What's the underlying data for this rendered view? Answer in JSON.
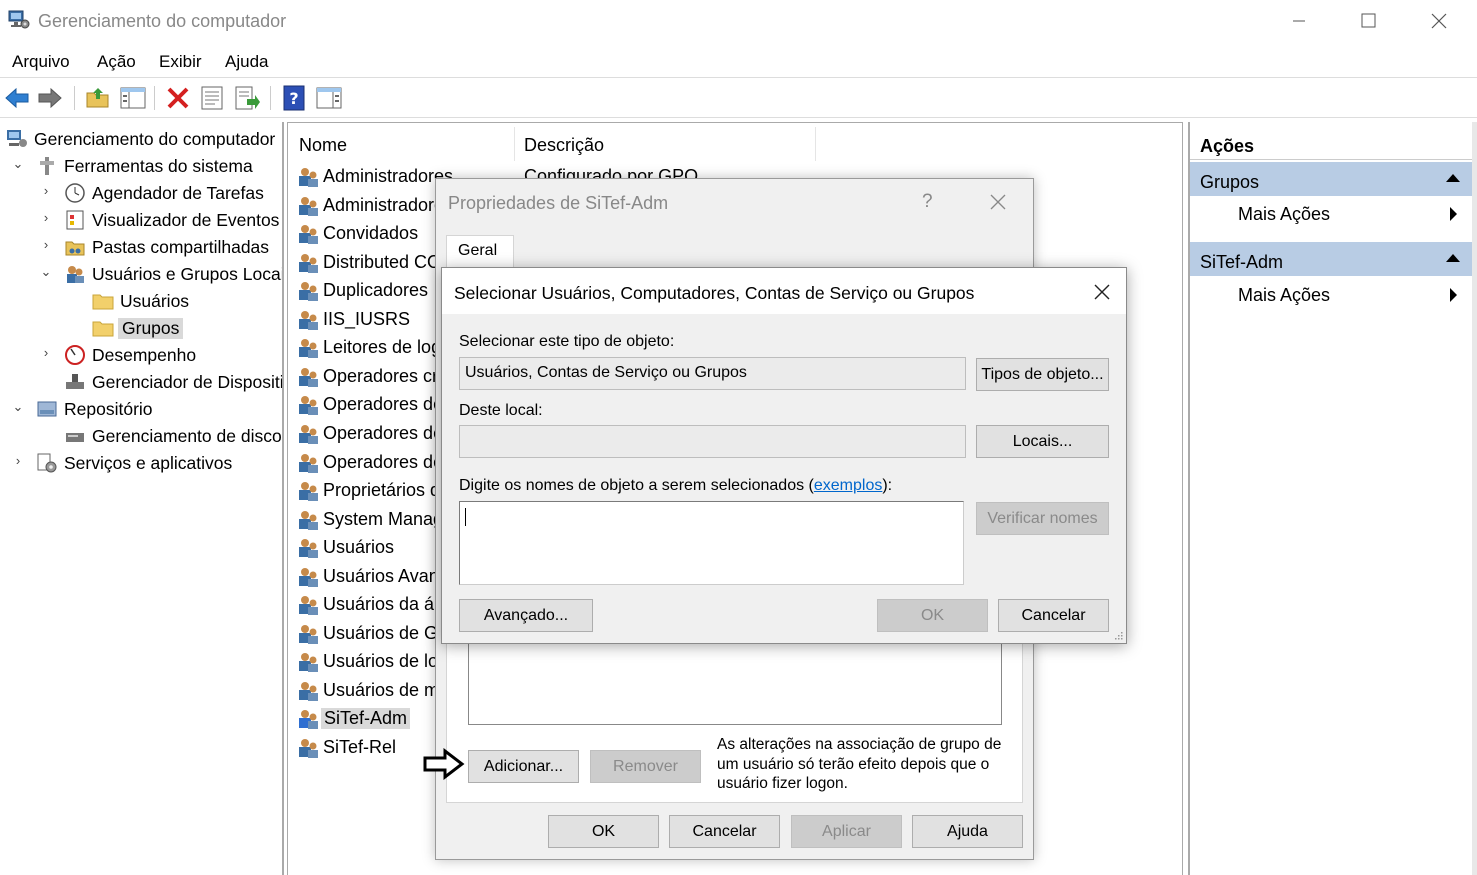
{
  "window": {
    "title": "Gerenciamento do computador"
  },
  "menu": [
    "Arquivo",
    "Ação",
    "Exibir",
    "Ajuda"
  ],
  "tree": {
    "root": "Gerenciamento do computador",
    "system_tools": "Ferramentas do sistema",
    "task_scheduler": "Agendador de Tarefas",
    "event_viewer": "Visualizador de Eventos",
    "shared_folders": "Pastas compartilhadas",
    "local_users_groups": "Usuários e Grupos Locais",
    "users": "Usuários",
    "groups": "Grupos",
    "performance": "Desempenho",
    "device_manager": "Gerenciador de Dispositivos",
    "storage": "Repositório",
    "disk_management": "Gerenciamento de disco",
    "services_apps": "Serviços e aplicativos"
  },
  "list": {
    "col_name": "Nome",
    "col_desc": "Descrição",
    "first_desc": "Configurado por GPO",
    "items": [
      "Administradores",
      "Administradores",
      "Convidados",
      "Distributed COM Users",
      "Duplicadores",
      "IIS_IUSRS",
      "Leitores de log de eventos",
      "Operadores criptográficos",
      "Operadores de backup",
      "Operadores de configuração de rede",
      "Operadores de controle de acesso",
      "Proprietários de dispositivos",
      "System Managed Accounts Group",
      "Usuários",
      "Usuários Avançados",
      "Usuários da área de trabalho remota",
      "Usuários de Gerenciamento Remoto",
      "Usuários de log de desempenho",
      "Usuários de monitor de desempenho",
      "SiTef-Adm",
      "SiTef-Rel"
    ]
  },
  "actions": {
    "title": "Ações",
    "group1": "Grupos",
    "group1_more": "Mais Ações",
    "group2": "SiTef-Adm",
    "group2_more": "Mais Ações"
  },
  "props_dialog": {
    "title": "Propriedades de SiTef-Adm",
    "help_glyph": "?",
    "tab": "Geral",
    "add": "Adicionar...",
    "remove": "Remover",
    "note": "As alterações na associação de grupo de um usuário só terão efeito depois que o usuário fizer logon.",
    "ok": "OK",
    "cancel": "Cancelar",
    "apply": "Aplicar",
    "help": "Ajuda"
  },
  "select_dialog": {
    "title": "Selecionar Usuários, Computadores, Contas de Serviço ou Grupos",
    "object_type_label": "Selecionar este tipo de objeto:",
    "object_type_value": "Usuários, Contas de Serviço ou Grupos",
    "object_types_btn": "Tipos de objeto...",
    "location_label": "Deste local:",
    "location_value": "",
    "locations_btn": "Locais...",
    "names_label_pre": "Digite os nomes de objeto a serem selecionados (",
    "names_label_link": "exemplos",
    "names_label_post": "):",
    "names_value": "",
    "check_names_btn": "Verificar nomes",
    "advanced_btn": "Avançado...",
    "ok": "OK",
    "cancel": "Cancelar"
  }
}
